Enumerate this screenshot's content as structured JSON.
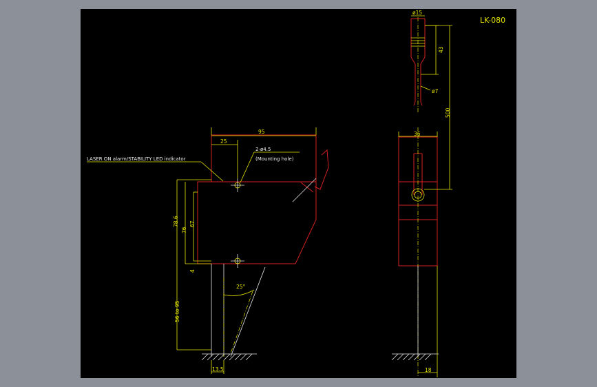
{
  "model": "LK-080",
  "notes": {
    "indicator": "LASER ON alarm/STABILITY LED indicator",
    "holes": "2-ø4.5",
    "holes_sub": "(Mounting hole)"
  },
  "dims": {
    "width_95": "95",
    "hole_25": "25",
    "height_78_6": "78.6",
    "height_76": "76",
    "height_67": "67",
    "gap_4": "4",
    "range": "56 to 95",
    "base_13_5": "13.5",
    "angle": "25°",
    "cable_dia_top": "ø15",
    "cable_43": "43",
    "cable_dia_7": "ø7",
    "cable_500": "500",
    "side_36": "36",
    "side_18": "18"
  },
  "colors": {
    "background": "#8b9099",
    "canvas": "#000000",
    "outline": "#d42020",
    "dimension": "#e6e600",
    "note": "#f0f0f0"
  }
}
